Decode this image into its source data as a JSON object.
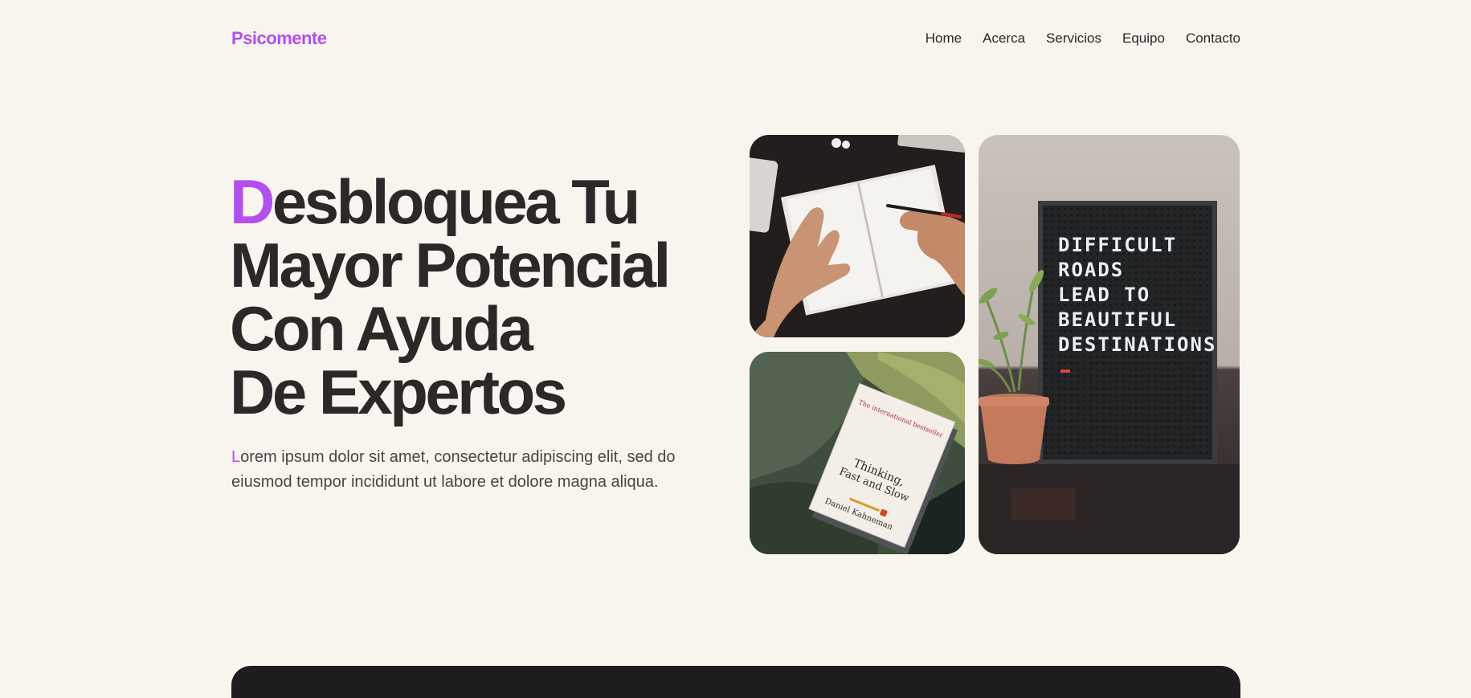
{
  "brand": {
    "name": "Psicomente",
    "accent_color": "#b34ff0"
  },
  "nav": {
    "items": [
      {
        "label": "Home"
      },
      {
        "label": "Acerca"
      },
      {
        "label": "Servicios"
      },
      {
        "label": "Equipo"
      },
      {
        "label": "Contacto"
      }
    ]
  },
  "hero": {
    "title_first_letter": "D",
    "title_line1_rest": "esbloquea Tu",
    "title_line2": "Mayor Potencial",
    "title_line3": "Con Ayuda",
    "title_line4": "De Expertos",
    "text_first_letter": "L",
    "text_rest": "orem ipsum dolor sit amet, consectetur adipiscing elit, sed do eiusmod tempor incididunt ut labore et dolore magna aliqua."
  },
  "images": {
    "notebook": {
      "icon": "photo-writing-in-notebook"
    },
    "book": {
      "icon": "photo-book-on-sofa",
      "book_top_text": "The international bestseller",
      "book_title_1": "Thinking,",
      "book_title_2": "Fast and Slow",
      "book_author": "Daniel Kahneman"
    },
    "board": {
      "icon": "photo-letter-board-with-plant",
      "board_lines": [
        "DIFFICULT",
        "ROADS",
        "LEAD TO",
        "BEAUTIFUL",
        "DESTINATIONS"
      ]
    }
  },
  "colors": {
    "background": "#f8f5ee",
    "text": "#2b2828",
    "accent": "#b34ff0"
  }
}
